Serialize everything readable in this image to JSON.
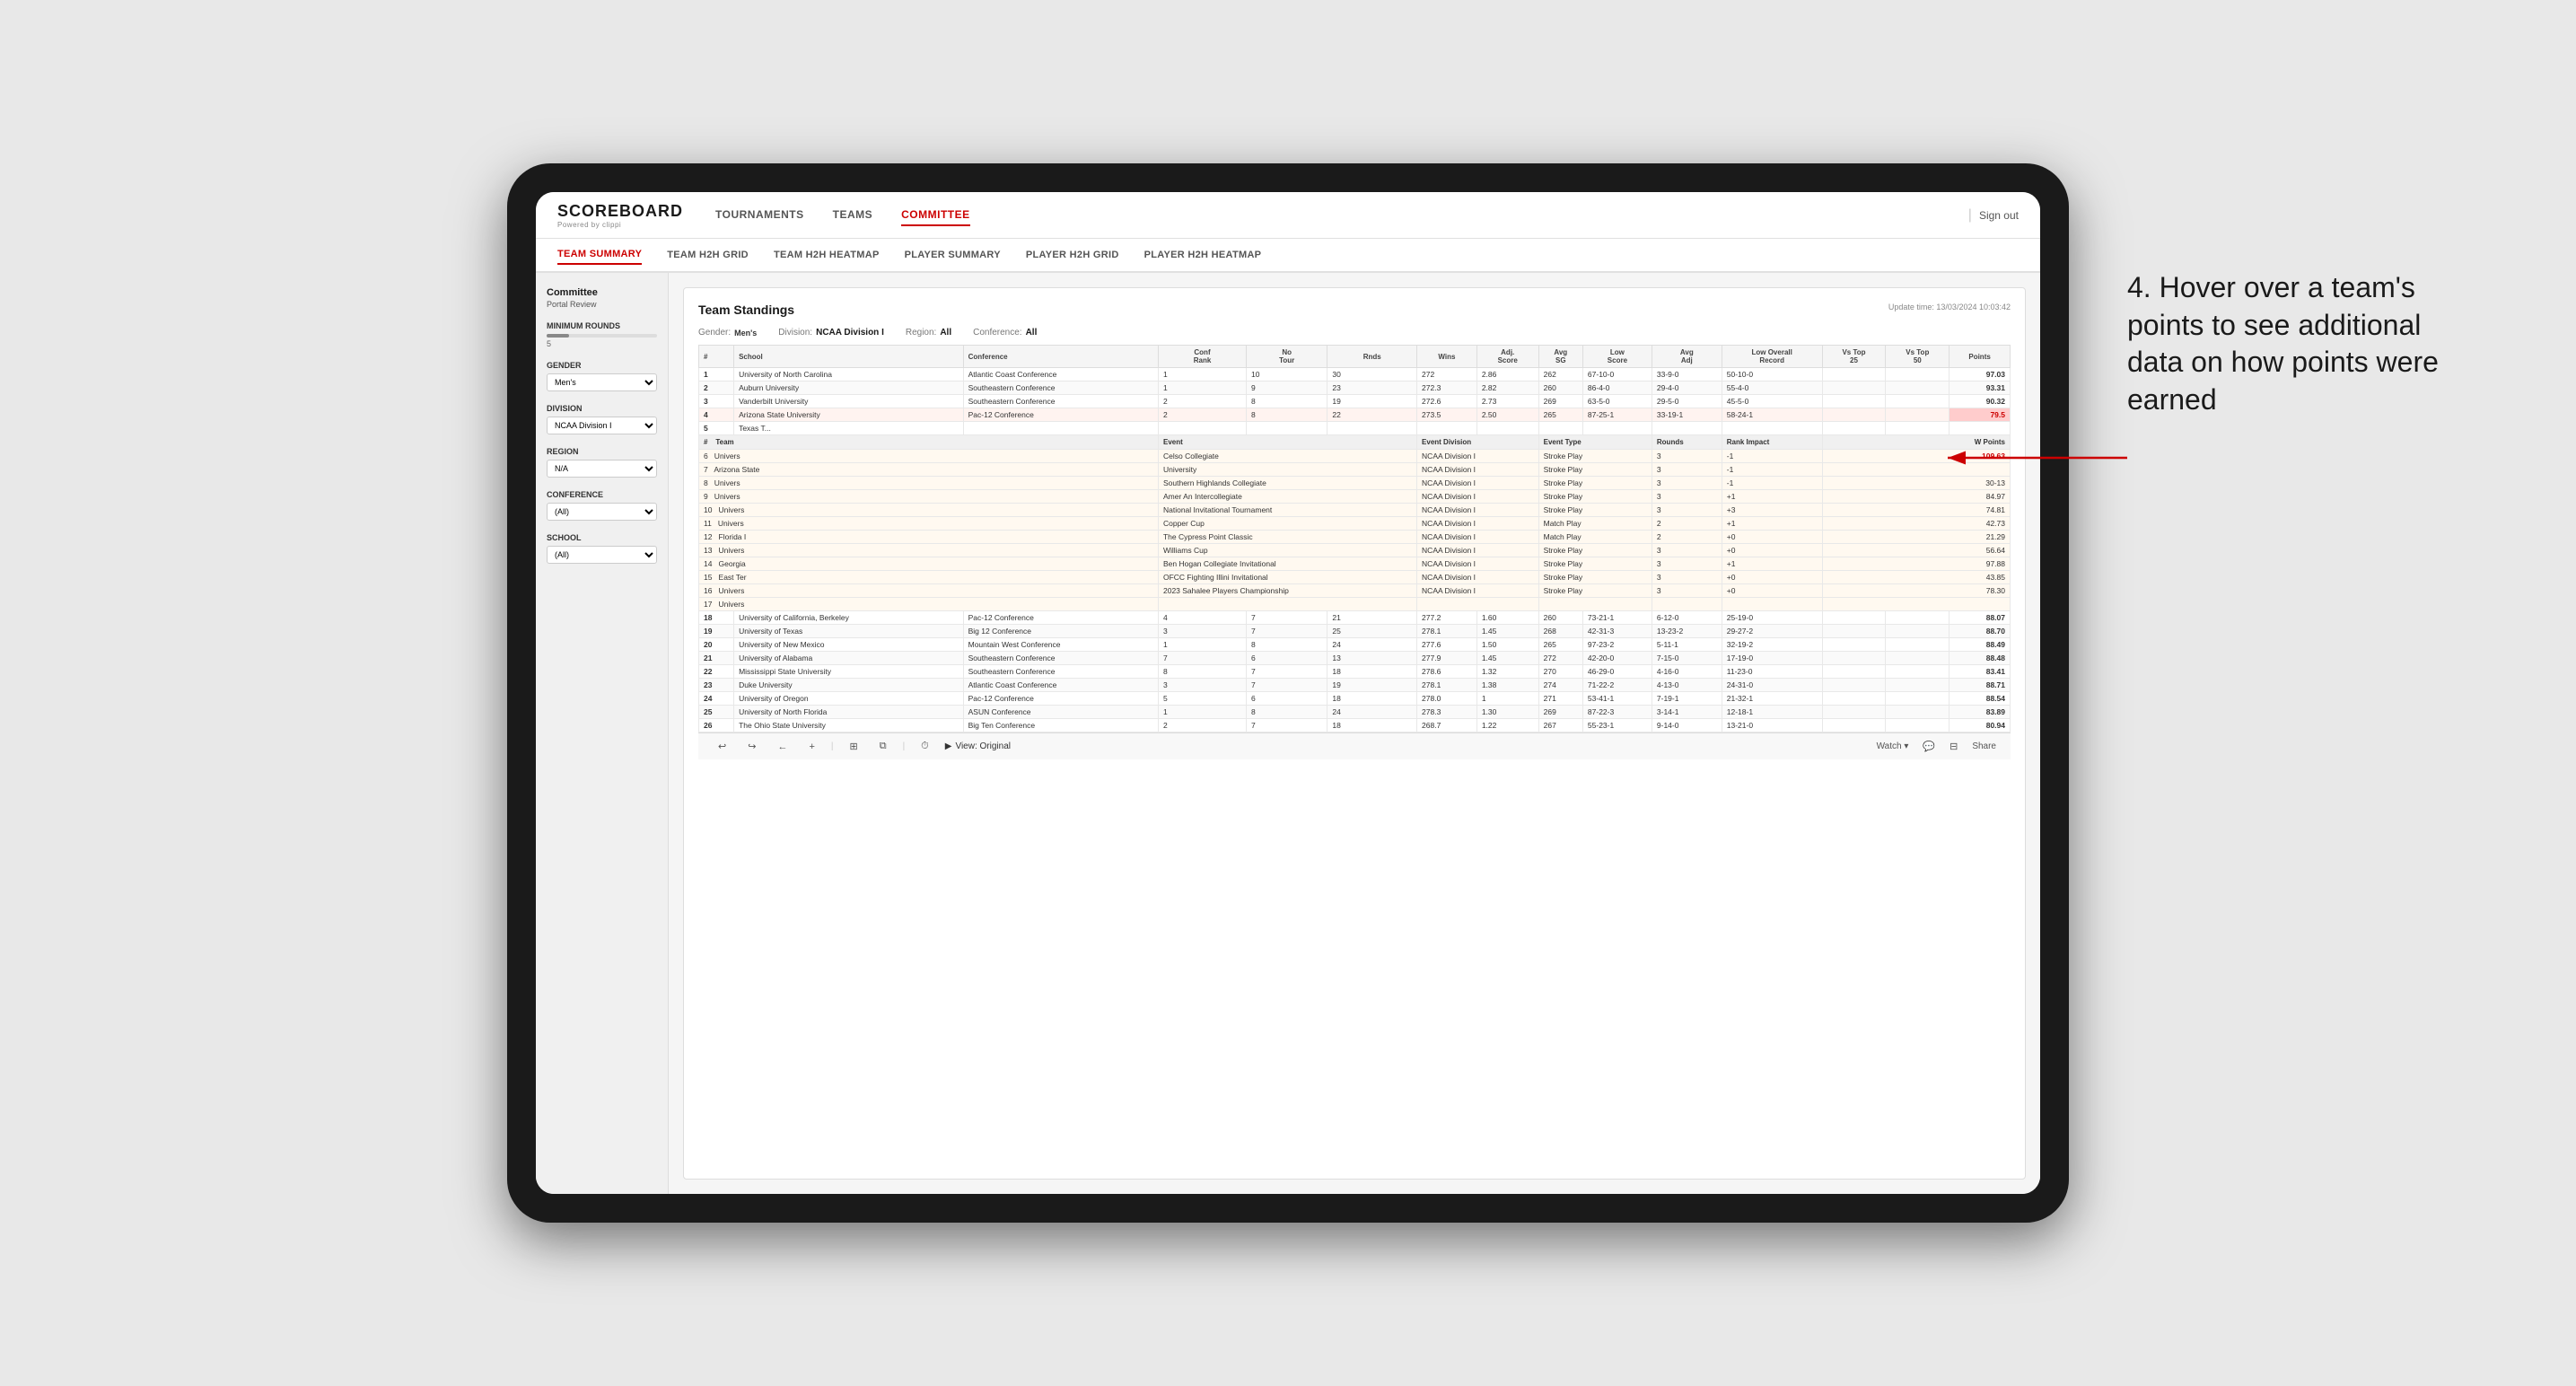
{
  "app": {
    "logo": "SCOREBOARD",
    "logo_sub": "Powered by clippi",
    "sign_out": "Sign out"
  },
  "nav": {
    "items": [
      {
        "label": "TOURNAMENTS",
        "active": false
      },
      {
        "label": "TEAMS",
        "active": false
      },
      {
        "label": "COMMITTEE",
        "active": true
      }
    ]
  },
  "sub_nav": {
    "items": [
      {
        "label": "TEAM SUMMARY",
        "active": true
      },
      {
        "label": "TEAM H2H GRID",
        "active": false
      },
      {
        "label": "TEAM H2H HEATMAP",
        "active": false
      },
      {
        "label": "PLAYER SUMMARY",
        "active": false
      },
      {
        "label": "PLAYER H2H GRID",
        "active": false
      },
      {
        "label": "PLAYER H2H HEATMAP",
        "active": false
      }
    ]
  },
  "sidebar": {
    "header": "Committee",
    "sub": "Portal Review",
    "min_rounds_label": "Minimum Rounds",
    "min_rounds_value": "5",
    "gender_label": "Gender",
    "gender_value": "Men's",
    "division_label": "Division",
    "division_value": "NCAA Division I",
    "region_label": "Region",
    "region_value": "N/A",
    "conference_label": "Conference",
    "conference_value": "(All)",
    "school_label": "School",
    "school_value": "(All)"
  },
  "report": {
    "title": "Team Standings",
    "update_time": "Update time: 13/03/2024 10:03:42",
    "gender": "Men's",
    "division": "NCAA Division I",
    "region": "All",
    "conference": "All",
    "col_headers": [
      "#",
      "School",
      "Conference",
      "Conf Rank",
      "No Tour",
      "Rnds",
      "Wins",
      "Adj Score",
      "Avg SG",
      "Low Score",
      "Avg Adj",
      "Low Overall Record",
      "Vs Top 25",
      "Vs Top 50",
      "Points"
    ],
    "teams": [
      {
        "rank": 1,
        "school": "University of North Carolina",
        "conference": "Atlantic Coast Conference",
        "conf_rank": 1,
        "tours": 10,
        "rnds": 30,
        "wins": 272,
        "adj_score": 2.86,
        "avg_sg": 262,
        "low_score": "67-10-0",
        "overall_record": "33-9-0",
        "vs_top25": "50-10-0",
        "vs_top50": "",
        "points": "97.03",
        "highlighted": false
      },
      {
        "rank": 2,
        "school": "Auburn University",
        "conference": "Southeastern Conference",
        "conf_rank": 1,
        "tours": 9,
        "rnds": 23,
        "wins": 272.3,
        "adj_score": 2.82,
        "avg_sg": 260,
        "low_score": "86-4-0",
        "overall_record": "29-4-0",
        "vs_top25": "55-4-0",
        "vs_top50": "",
        "points": "93.31",
        "highlighted": false
      },
      {
        "rank": 3,
        "school": "Vanderbilt University",
        "conference": "Southeastern Conference",
        "conf_rank": 2,
        "tours": 8,
        "rnds": 19,
        "wins": 272.6,
        "adj_score": 2.73,
        "avg_sg": 269,
        "low_score": "63-5-0",
        "overall_record": "29-5-0",
        "vs_top25": "45-5-0",
        "vs_top50": "",
        "points": "90.32",
        "highlighted": false
      },
      {
        "rank": 4,
        "school": "Arizona State University",
        "conference": "Pac-12 Conference",
        "conf_rank": 2,
        "tours": 8,
        "rnds": 22,
        "wins": 273.5,
        "adj_score": 2.5,
        "avg_sg": 265,
        "low_score": "87-25-1",
        "overall_record": "33-19-1",
        "vs_top25": "58-24-1",
        "vs_top50": "",
        "points": "79.5",
        "highlighted": true
      },
      {
        "rank": 5,
        "school": "Texas T...",
        "conference": "",
        "conf_rank": "",
        "tours": "",
        "rnds": "",
        "wins": "",
        "adj_score": "",
        "avg_sg": "",
        "low_score": "",
        "overall_record": "",
        "vs_top25": "",
        "vs_top50": "",
        "points": "",
        "highlighted": false
      },
      {
        "rank": 6,
        "school": "Univers",
        "conference": "Celso Collegiate",
        "conf_rank": "",
        "tours": "",
        "rnds": "",
        "wins": "",
        "adj_score": "",
        "avg_sg": "",
        "low_score": "",
        "overall_record": "",
        "vs_top25": "",
        "vs_top50": "",
        "points": "",
        "tooltip": true
      },
      {
        "rank": 7,
        "school": "Arizona State",
        "conference": "University",
        "conf_rank": "",
        "tours": "",
        "rnds": "",
        "wins": "",
        "adj_score": "",
        "avg_sg": "",
        "low_score": "",
        "overall_record": "",
        "vs_top25": "",
        "vs_top50": "",
        "points": "",
        "tooltip": true
      },
      {
        "rank": 8,
        "school": "Univers",
        "conference": "Southern Highlands Collegiate",
        "conf_rank": "",
        "tours": "",
        "rnds": "",
        "wins": "",
        "adj_score": "",
        "avg_sg": "",
        "low_score": "",
        "overall_record": "",
        "vs_top25": "",
        "vs_top50": "",
        "points": "30-13",
        "tooltip": true
      },
      {
        "rank": 9,
        "school": "Univers",
        "conference": "Amer An Intercollegiate",
        "conf_rank": "",
        "tours": "",
        "rnds": "",
        "wins": "",
        "adj_score": "",
        "avg_sg": "",
        "low_score": "",
        "overall_record": "",
        "vs_top25": "",
        "vs_top50": "",
        "points": "84.97",
        "tooltip": true
      },
      {
        "rank": 10,
        "school": "Univers",
        "conference": "National Invitational Tournament",
        "conf_rank": "",
        "tours": "",
        "rnds": "",
        "wins": "",
        "adj_score": "",
        "avg_sg": "",
        "low_score": "",
        "overall_record": "",
        "vs_top25": "+3",
        "vs_top50": "",
        "points": "74.81",
        "tooltip": true
      },
      {
        "rank": 11,
        "school": "Univers",
        "conference": "Copper Cup",
        "conf_rank": "",
        "tours": "",
        "rnds": "",
        "wins": "",
        "adj_score": "",
        "avg_sg": "",
        "low_score": "",
        "overall_record": "",
        "vs_top25": "+1",
        "vs_top50": "",
        "points": "42.73",
        "tooltip": true
      },
      {
        "rank": 12,
        "school": "Florida I",
        "conference": "The Cypress Point Classic",
        "conf_rank": "",
        "tours": "",
        "rnds": "",
        "wins": "",
        "adj_score": "",
        "avg_sg": "",
        "low_score": "",
        "overall_record": "",
        "vs_top25": "+0",
        "vs_top50": "",
        "points": "21.29",
        "tooltip": true
      },
      {
        "rank": 13,
        "school": "Univers",
        "conference": "Williams Cup",
        "conf_rank": "",
        "tours": "",
        "rnds": "",
        "wins": "",
        "adj_score": "",
        "avg_sg": "",
        "low_score": "",
        "overall_record": "",
        "vs_top25": "+0",
        "vs_top50": "",
        "points": "56.64",
        "tooltip": true
      },
      {
        "rank": 14,
        "school": "Georgia",
        "conference": "Ben Hogan Collegiate Invitational",
        "conf_rank": "",
        "tours": "",
        "rnds": "",
        "wins": "",
        "adj_score": "",
        "avg_sg": "",
        "low_score": "",
        "overall_record": "",
        "vs_top25": "+1",
        "vs_top50": "",
        "points": "97.88",
        "tooltip": true
      },
      {
        "rank": 15,
        "school": "East Ter",
        "conference": "OFCC Fighting Illini Invitational",
        "conf_rank": "",
        "tours": "",
        "rnds": "",
        "wins": "",
        "adj_score": "",
        "avg_sg": "",
        "low_score": "",
        "overall_record": "",
        "vs_top25": "+0",
        "vs_top50": "",
        "points": "43.85",
        "tooltip": true
      },
      {
        "rank": 16,
        "school": "Univers",
        "conference": "2023 Sahalee Players Championship",
        "conf_rank": "",
        "tours": "",
        "rnds": "",
        "wins": "",
        "adj_score": "",
        "avg_sg": "",
        "low_score": "",
        "overall_record": "",
        "vs_top25": "+0",
        "vs_top50": "",
        "points": "78.30",
        "tooltip": true
      },
      {
        "rank": 17,
        "school": "Univers",
        "conference": "",
        "conf_rank": "",
        "tours": "",
        "rnds": "",
        "wins": "",
        "adj_score": "",
        "avg_sg": "",
        "low_score": "",
        "overall_record": "",
        "vs_top25": "",
        "vs_top50": "",
        "points": "",
        "tooltip": true
      },
      {
        "rank": 18,
        "school": "University of California, Berkeley",
        "conference": "Pac-12 Conference",
        "conf_rank": 4,
        "tours": 7,
        "rnds": 21,
        "wins": 277.2,
        "adj_score": 1.6,
        "avg_sg": 260,
        "low_score": "73-21-1",
        "overall_record": "6-12-0",
        "vs_top25": "25-19-0",
        "vs_top50": "",
        "points": "88.07",
        "highlighted": false
      },
      {
        "rank": 19,
        "school": "University of Texas",
        "conference": "Big 12 Conference",
        "conf_rank": 3,
        "tours": 7,
        "rnds": 25,
        "wins": 278.1,
        "adj_score": 1.45,
        "avg_sg": 268,
        "low_score": "42-31-3",
        "overall_record": "13-23-2",
        "vs_top25": "29-27-2",
        "vs_top50": "",
        "points": "88.70",
        "highlighted": false
      },
      {
        "rank": 20,
        "school": "University of New Mexico",
        "conference": "Mountain West Conference",
        "conf_rank": 1,
        "tours": 8,
        "rnds": 24,
        "wins": 277.6,
        "adj_score": 1.5,
        "avg_sg": 265,
        "low_score": "97-23-2",
        "overall_record": "5-11-1",
        "vs_top25": "32-19-2",
        "vs_top50": "",
        "points": "88.49",
        "highlighted": false
      },
      {
        "rank": 21,
        "school": "University of Alabama",
        "conference": "Southeastern Conference",
        "conf_rank": 7,
        "tours": 6,
        "rnds": 13,
        "wins": 277.9,
        "adj_score": 1.45,
        "avg_sg": 272,
        "low_score": "42-20-0",
        "overall_record": "7-15-0",
        "vs_top25": "17-19-0",
        "vs_top50": "",
        "points": "88.48",
        "highlighted": false
      },
      {
        "rank": 22,
        "school": "Mississippi State University",
        "conference": "Southeastern Conference",
        "conf_rank": 8,
        "tours": 7,
        "rnds": 18,
        "wins": 278.6,
        "adj_score": 1.32,
        "avg_sg": 270,
        "low_score": "46-29-0",
        "overall_record": "4-16-0",
        "vs_top25": "11-23-0",
        "vs_top50": "",
        "points": "83.41",
        "highlighted": false
      },
      {
        "rank": 23,
        "school": "Duke University",
        "conference": "Atlantic Coast Conference",
        "conf_rank": 3,
        "tours": 7,
        "rnds": 19,
        "wins": 278.1,
        "adj_score": 1.38,
        "avg_sg": 274,
        "low_score": "71-22-2",
        "overall_record": "4-13-0",
        "vs_top25": "24-31-0",
        "vs_top50": "",
        "points": "88.71",
        "highlighted": false
      },
      {
        "rank": 24,
        "school": "University of Oregon",
        "conference": "Pac-12 Conference",
        "conf_rank": 5,
        "tours": 6,
        "rnds": 18,
        "wins": 278.0,
        "adj_score": 1,
        "avg_sg": 271,
        "low_score": "53-41-1",
        "overall_record": "7-19-1",
        "vs_top25": "21-32-1",
        "vs_top50": "",
        "points": "88.54",
        "highlighted": false
      },
      {
        "rank": 25,
        "school": "University of North Florida",
        "conference": "ASUN Conference",
        "conf_rank": 1,
        "tours": 8,
        "rnds": 24,
        "wins": 278.3,
        "adj_score": 1.3,
        "avg_sg": 269,
        "low_score": "87-22-3",
        "overall_record": "3-14-1",
        "vs_top25": "12-18-1",
        "vs_top50": "",
        "points": "83.89",
        "highlighted": false
      },
      {
        "rank": 26,
        "school": "The Ohio State University",
        "conference": "Big Ten Conference",
        "conf_rank": 2,
        "tours": 7,
        "rnds": 18,
        "wins": 268.7,
        "adj_score": 1.22,
        "avg_sg": 267,
        "low_score": "55-23-1",
        "overall_record": "9-14-0",
        "vs_top25": "13-21-0",
        "vs_top50": "",
        "points": "80.94",
        "highlighted": false
      }
    ],
    "tooltip_data": {
      "title": "Team",
      "headers": [
        "Team",
        "Event",
        "Event Division",
        "Event Type",
        "Rounds",
        "Rank Impact",
        "W Points"
      ],
      "rows": [
        {
          "team": "Arizona State University",
          "event": "Celso Collegiate",
          "division": "NCAA Division I",
          "type": "Stroke Play",
          "rounds": 3,
          "rank_impact": -1,
          "points": "109.63"
        },
        {
          "team": "Arizona State",
          "event": "",
          "division": "NCAA Division I",
          "type": "Stroke Play",
          "rounds": 3,
          "rank_impact": -1,
          "points": ""
        },
        {
          "team": "Univers",
          "event": "Southern Highlands Collegiate",
          "division": "NCAA Division I",
          "type": "Stroke Play",
          "rounds": 3,
          "rank_impact": -1,
          "points": "30-13"
        },
        {
          "team": "Univers",
          "event": "Amer An Intercollegiate",
          "division": "NCAA Division I",
          "type": "Stroke Play",
          "rounds": 3,
          "rank_impact": "+1",
          "points": "84.97"
        },
        {
          "team": "Univers",
          "event": "National Invitational Tournament",
          "division": "NCAA Division I",
          "type": "Stroke Play",
          "rounds": 3,
          "rank_impact": "+3",
          "points": "74.81"
        },
        {
          "team": "Univers",
          "event": "Copper Cup",
          "division": "NCAA Division I",
          "type": "Match Play",
          "rounds": 2,
          "rank_impact": "+1",
          "points": "42.73"
        },
        {
          "team": "Florida I",
          "event": "The Cypress Point Classic",
          "division": "NCAA Division I",
          "type": "Match Play",
          "rounds": 2,
          "rank_impact": "+0",
          "points": "21.29"
        },
        {
          "team": "Univers",
          "event": "Williams Cup",
          "division": "NCAA Division I",
          "type": "Stroke Play",
          "rounds": 3,
          "rank_impact": "+0",
          "points": "56.64"
        },
        {
          "team": "Georgia",
          "event": "Ben Hogan Collegiate Invitational",
          "division": "NCAA Division I",
          "type": "Stroke Play",
          "rounds": 3,
          "rank_impact": "+1",
          "points": "97.88"
        },
        {
          "team": "East Ter",
          "event": "OFCC Fighting Illini Invitational",
          "division": "NCAA Division I",
          "type": "Stroke Play",
          "rounds": 3,
          "rank_impact": "+0",
          "points": "43.85"
        },
        {
          "team": "Univers",
          "event": "2023 Sahalee Players Championship",
          "division": "NCAA Division I",
          "type": "Stroke Play",
          "rounds": 3,
          "rank_impact": "+0",
          "points": "78.30"
        }
      ]
    }
  },
  "toolbar": {
    "undo": "↩",
    "redo": "↪",
    "back": "←",
    "add": "+",
    "grid": "⊞",
    "clock": "⏱",
    "view_label": "View: Original",
    "watch_label": "Watch ▾",
    "share_label": "Share"
  },
  "annotation": {
    "text": "4. Hover over a team's points to see additional data on how points were earned"
  }
}
